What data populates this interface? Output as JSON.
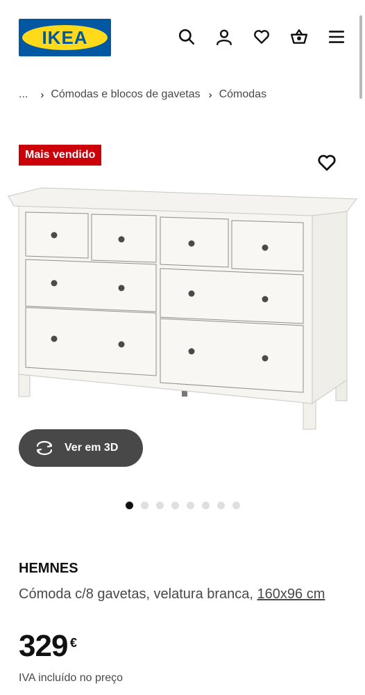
{
  "header": {
    "logo_text": "IKEA",
    "icons": [
      "search-icon",
      "user-icon",
      "heart-icon",
      "basket-icon",
      "menu-icon"
    ]
  },
  "breadcrumb": {
    "ellipsis": "...",
    "items": [
      "Cómodas e blocos de gavetas",
      "Cómodas"
    ]
  },
  "product": {
    "badge": "Mais vendido",
    "view_3d_label": "Ver em 3D",
    "gallery": {
      "image_count": 8,
      "active_index": 0
    },
    "name": "HEMNES",
    "description": "Cómoda c/8 gavetas, velatura branca,",
    "size": "160x96 cm",
    "price": "329",
    "currency": "€",
    "vat_note": "IVA incluído no preço"
  },
  "colors": {
    "ikea_blue": "#0058a3",
    "ikea_yellow": "#ffda1a",
    "badge_red": "#cc0008",
    "button_dark": "#484848"
  }
}
